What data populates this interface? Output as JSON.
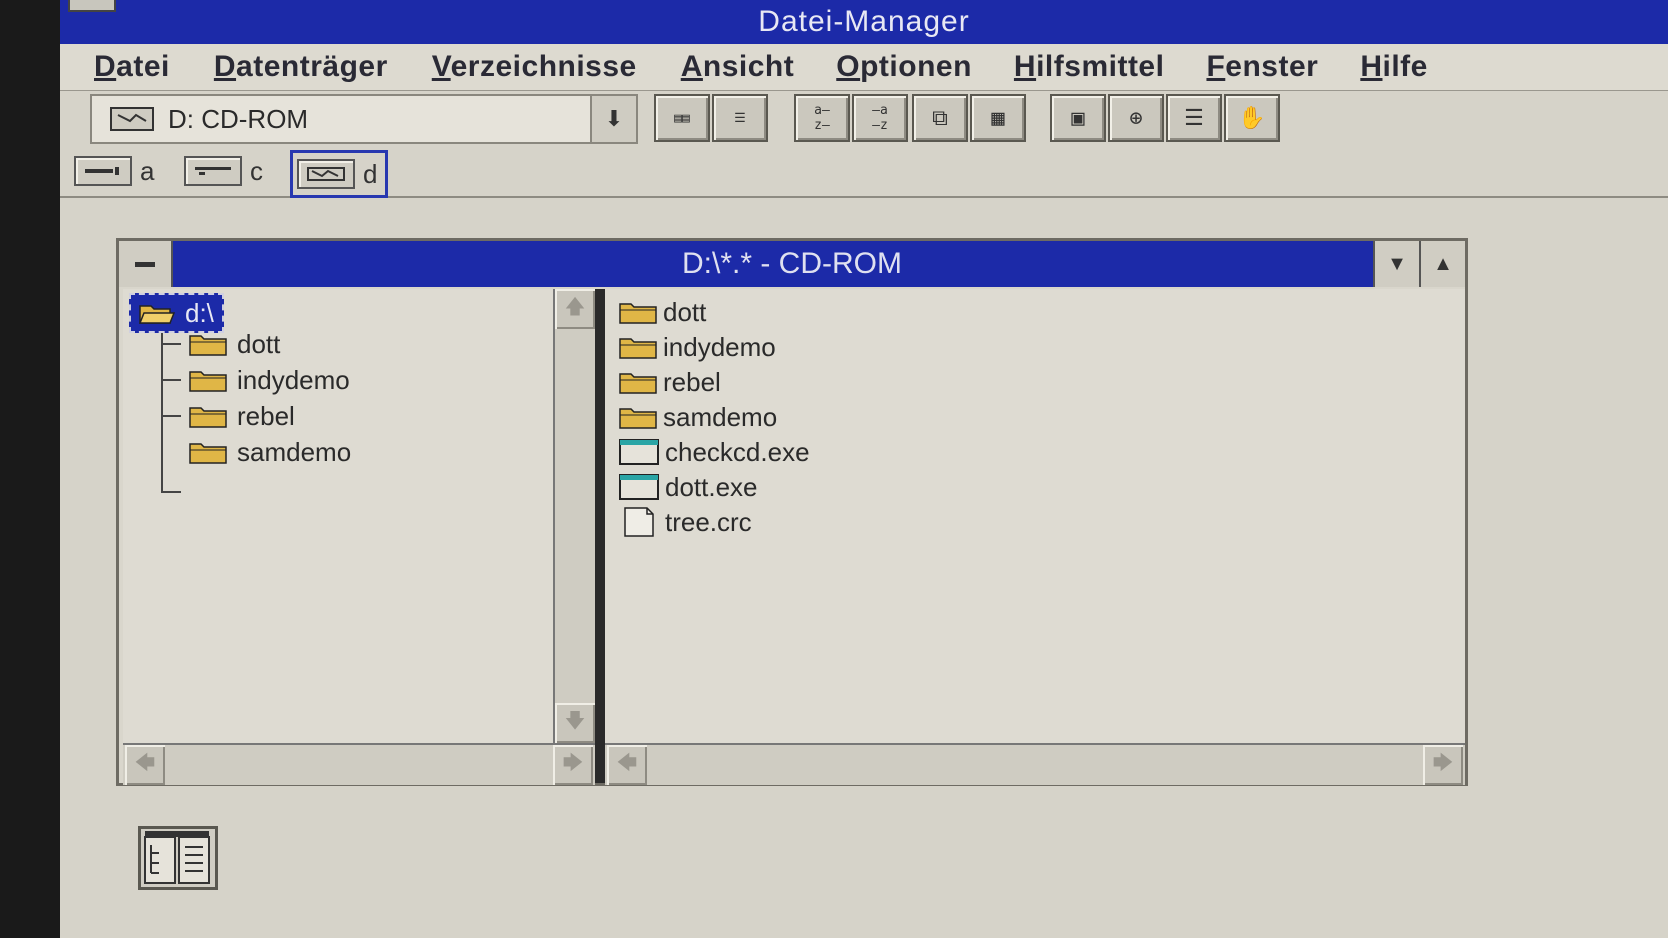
{
  "app": {
    "title": "Datei-Manager"
  },
  "menu": [
    "Datei",
    "Datenträger",
    "Verzeichnisse",
    "Ansicht",
    "Optionen",
    "Hilfsmittel",
    "Fenster",
    "Hilfe"
  ],
  "toolbar": {
    "drive_select_value": "D: CD-ROM",
    "buttons": [
      {
        "name": "tree-and-dir-view-button",
        "icon": "tree-dir-icon"
      },
      {
        "name": "dir-only-view-button",
        "icon": "list-icon"
      },
      {
        "name": "sort-by-name-button",
        "icon": "sort-name-icon"
      },
      {
        "name": "sort-by-type-button",
        "icon": "sort-type-icon"
      },
      {
        "name": "copy-button",
        "icon": "copy-icon"
      },
      {
        "name": "details-button",
        "icon": "details-icon"
      },
      {
        "name": "connect-drive-button",
        "icon": "disk-icon"
      },
      {
        "name": "share-button",
        "icon": "share-icon"
      },
      {
        "name": "stop-share-button",
        "icon": "stack-icon"
      },
      {
        "name": "disconnect-button",
        "icon": "hand-icon"
      }
    ]
  },
  "drives": [
    {
      "letter": "a",
      "icon": "floppy-drive-icon",
      "active": false
    },
    {
      "letter": "c",
      "icon": "hard-drive-icon",
      "active": false
    },
    {
      "letter": "d",
      "icon": "cdrom-drive-icon",
      "active": true
    }
  ],
  "window": {
    "title": "D:\\*.* - CD-ROM",
    "tree": {
      "root": "d:\\",
      "items": [
        "dott",
        "indydemo",
        "rebel",
        "samdemo"
      ]
    },
    "files": [
      {
        "name": "dott",
        "type": "folder"
      },
      {
        "name": "indydemo",
        "type": "folder"
      },
      {
        "name": "rebel",
        "type": "folder"
      },
      {
        "name": "samdemo",
        "type": "folder"
      },
      {
        "name": "checkcd.exe",
        "type": "program"
      },
      {
        "name": "dott.exe",
        "type": "program"
      },
      {
        "name": "tree.crc",
        "type": "document"
      }
    ]
  },
  "colors": {
    "titlebar": "#1c2aa8",
    "desktop": "#d6d3c9",
    "folder": "#e0b646"
  }
}
